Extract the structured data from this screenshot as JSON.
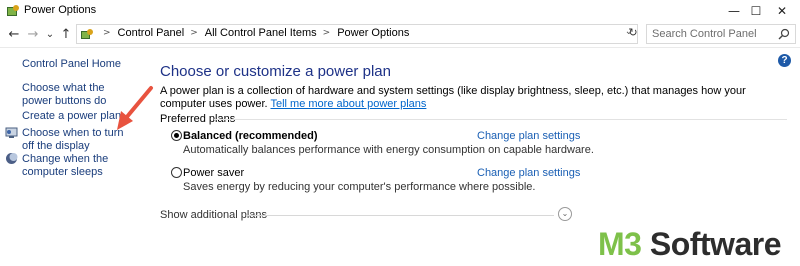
{
  "window": {
    "title": "Power Options",
    "minimize": "—",
    "maximize": "☐",
    "close": "✕"
  },
  "nav": {
    "back": "←",
    "forward": "→",
    "recent": "⌄",
    "up": "↑",
    "refresh": "↻",
    "breadcrumb": [
      "Control Panel",
      "All Control Panel Items",
      "Power Options"
    ],
    "separator": ">",
    "address_dropdown": "⌄",
    "search_placeholder": "Search Control Panel"
  },
  "sidebar": {
    "home": "Control Panel Home",
    "items": [
      {
        "label": "Choose what the power buttons do"
      },
      {
        "label": "Create a power plan"
      },
      {
        "label": "Choose when to turn off the display",
        "icon": "monitor-icon"
      },
      {
        "label": "Change when the computer sleeps",
        "icon": "moon-icon"
      }
    ]
  },
  "main": {
    "heading": "Choose or customize a power plan",
    "description": "A power plan is a collection of hardware and system settings (like display brightness, sleep, etc.) that manages how your computer uses power.",
    "description_link": "Tell me more about power plans",
    "section_label": "Preferred plans",
    "plans": [
      {
        "name": "Balanced (recommended)",
        "description": "Automatically balances performance with energy consumption on capable hardware.",
        "link": "Change plan settings",
        "selected": true
      },
      {
        "name": "Power saver",
        "description": "Saves energy by reducing your computer's performance where possible.",
        "link": "Change plan settings",
        "selected": false
      }
    ],
    "show_more": "Show additional plans",
    "expand": "⌄",
    "help": "?"
  },
  "watermark": {
    "prefix": "M3",
    "suffix": " Software"
  },
  "colors": {
    "link": "#1a3d7c",
    "heading": "#1e3287",
    "arrow": "#e8533f",
    "watermark_accent": "#7ec14a"
  }
}
